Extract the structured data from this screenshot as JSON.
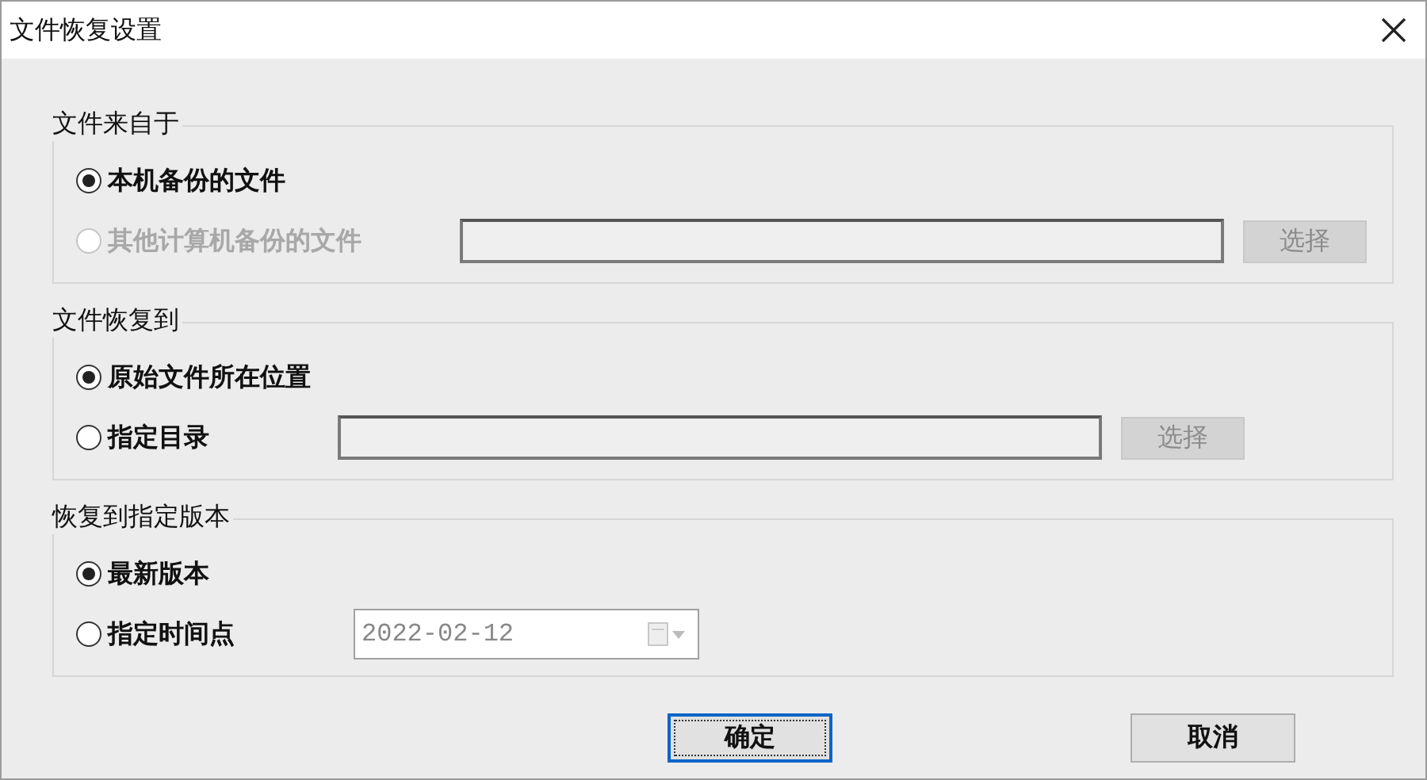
{
  "window": {
    "title": "文件恢复设置"
  },
  "groups": [
    {
      "legend": "文件来自于",
      "options": [
        {
          "kind": "plain",
          "label": "本机备份的文件",
          "selected": true,
          "disabled": false
        },
        {
          "kind": "path",
          "label": "其他计算机备份的文件",
          "selected": false,
          "disabled": true,
          "field": {
            "disabled": false
          },
          "button": {
            "label": "选择",
            "disabled": true
          }
        }
      ]
    },
    {
      "legend": "文件恢复到",
      "options": [
        {
          "kind": "plain",
          "label": "原始文件所在位置",
          "selected": true,
          "disabled": false
        },
        {
          "kind": "path",
          "label": "指定目录",
          "selected": false,
          "disabled": false,
          "field": {
            "disabled": false
          },
          "button": {
            "label": "选择",
            "disabled": true
          }
        }
      ]
    },
    {
      "legend": "恢复到指定版本",
      "options": [
        {
          "kind": "plain",
          "label": "最新版本",
          "selected": true,
          "disabled": false
        },
        {
          "kind": "date",
          "label": "指定时间点",
          "selected": false,
          "disabled": false,
          "field": {
            "value": "2022-02-12",
            "disabled": true
          }
        }
      ]
    }
  ],
  "buttons": [
    {
      "label": "确定",
      "default": true
    },
    {
      "label": "取消",
      "default": false
    }
  ]
}
